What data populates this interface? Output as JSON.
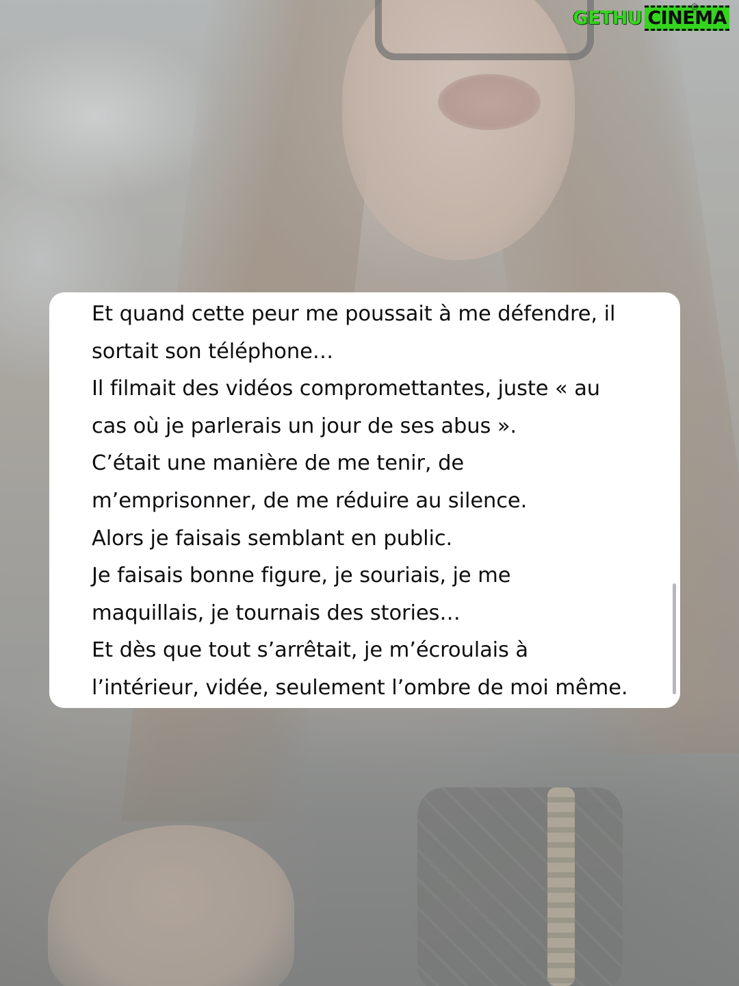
{
  "watermark": {
    "part1": "GETHU",
    "part2": "CINEMA"
  },
  "card": {
    "lines": [
      "Et quand cette peur me poussait à me défendre, il",
      "sortait son téléphone…",
      "Il filmait des vidéos compromettantes, juste « au",
      "cas où je parlerais un jour de ses abus ».",
      "C’était une manière de me tenir, de",
      "m’emprisonner, de me réduire au silence.",
      "Alors je faisais semblant en public.",
      "Je faisais bonne figure, je souriais, je me",
      "maquillais, je tournais des stories…",
      "Et dès que tout s’arrêtait, je m’écroulais à",
      "l’intérieur, vidée, seulement l’ombre de moi même."
    ]
  },
  "icons": {
    "watermark_camera": "camera-icon"
  }
}
